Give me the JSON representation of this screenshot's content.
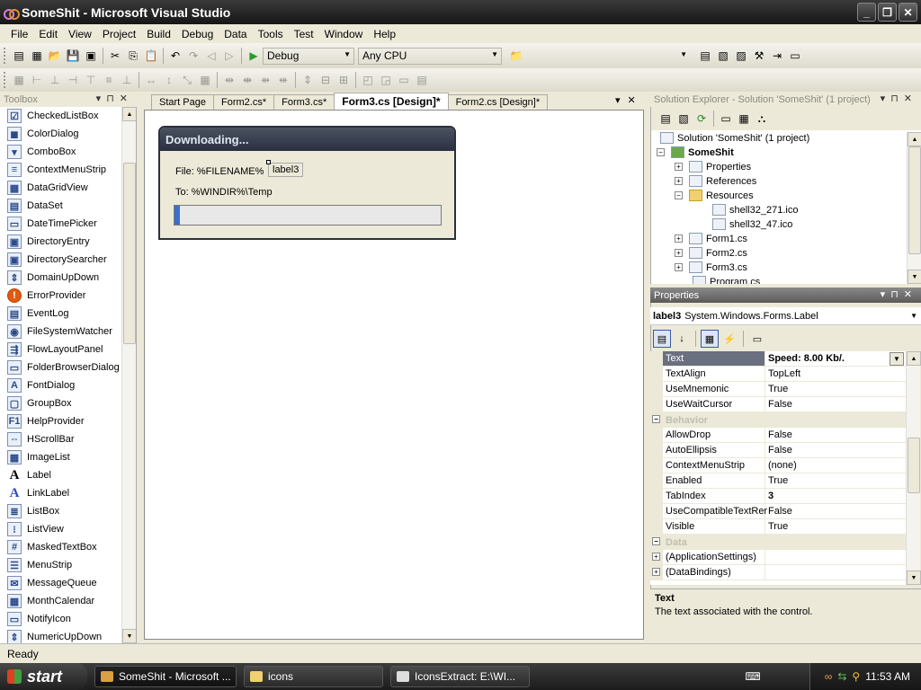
{
  "window": {
    "title": "SomeShit - Microsoft Visual Studio"
  },
  "menu": [
    "File",
    "Edit",
    "View",
    "Project",
    "Build",
    "Debug",
    "Data",
    "Tools",
    "Test",
    "Window",
    "Help"
  ],
  "toolbar": {
    "config": "Debug",
    "platform": "Any CPU"
  },
  "toolbox": {
    "title": "Toolbox",
    "items": [
      "CheckedListBox",
      "ColorDialog",
      "ComboBox",
      "ContextMenuStrip",
      "DataGridView",
      "DataSet",
      "DateTimePicker",
      "DirectoryEntry",
      "DirectorySearcher",
      "DomainUpDown",
      "ErrorProvider",
      "EventLog",
      "FileSystemWatcher",
      "FlowLayoutPanel",
      "FolderBrowserDialog",
      "FontDialog",
      "GroupBox",
      "HelpProvider",
      "HScrollBar",
      "ImageList",
      "Label",
      "LinkLabel",
      "ListBox",
      "ListView",
      "MaskedTextBox",
      "MenuStrip",
      "MessageQueue",
      "MonthCalendar",
      "NotifyIcon",
      "NumericUpDown"
    ]
  },
  "doctabs": [
    "Start Page",
    "Form2.cs*",
    "Form3.cs*",
    "Form3.cs [Design]*",
    "Form2.cs [Design]*"
  ],
  "form": {
    "title": "Downloading...",
    "file_label": "File: %FILENAME%",
    "label3": "label3",
    "to_label": "To: %WINDIR%\\Temp",
    "progress": 0.02
  },
  "solution": {
    "title": "Solution Explorer - Solution 'SomeShit' (1 project)",
    "nodes": [
      "Solution 'SomeShit' (1 project)",
      "SomeShit",
      "Properties",
      "References",
      "Resources",
      "shell32_271.ico",
      "shell32_47.ico",
      "Form1.cs",
      "Form2.cs",
      "Form3.cs",
      "Program.cs"
    ]
  },
  "properties": {
    "title": "Properties",
    "object": "label3",
    "object_type": "System.Windows.Forms.Label",
    "rows": [
      {
        "name": "Text",
        "value": "Speed: 8.00 Kb/."
      },
      {
        "name": "TextAlign",
        "value": "TopLeft"
      },
      {
        "name": "UseMnemonic",
        "value": "True"
      },
      {
        "name": "UseWaitCursor",
        "value": "False"
      },
      {
        "name": "Behavior",
        "value": ""
      },
      {
        "name": "AllowDrop",
        "value": "False"
      },
      {
        "name": "AutoEllipsis",
        "value": "False"
      },
      {
        "name": "ContextMenuStrip",
        "value": "(none)"
      },
      {
        "name": "Enabled",
        "value": "True"
      },
      {
        "name": "TabIndex",
        "value": "3"
      },
      {
        "name": "UseCompatibleTextRer",
        "value": "False"
      },
      {
        "name": "Visible",
        "value": "True"
      },
      {
        "name": "Data",
        "value": ""
      },
      {
        "name": "(ApplicationSettings)",
        "value": ""
      },
      {
        "name": "(DataBindings)",
        "value": ""
      }
    ],
    "desc_title": "Text",
    "desc_text": "The text associated with the control."
  },
  "status": "Ready",
  "taskbar": {
    "start": "start",
    "tasks": [
      "SomeShit - Microsoft ...",
      "icons",
      "IconsExtract:  E:\\WI..."
    ],
    "clock": "11:53 AM"
  }
}
